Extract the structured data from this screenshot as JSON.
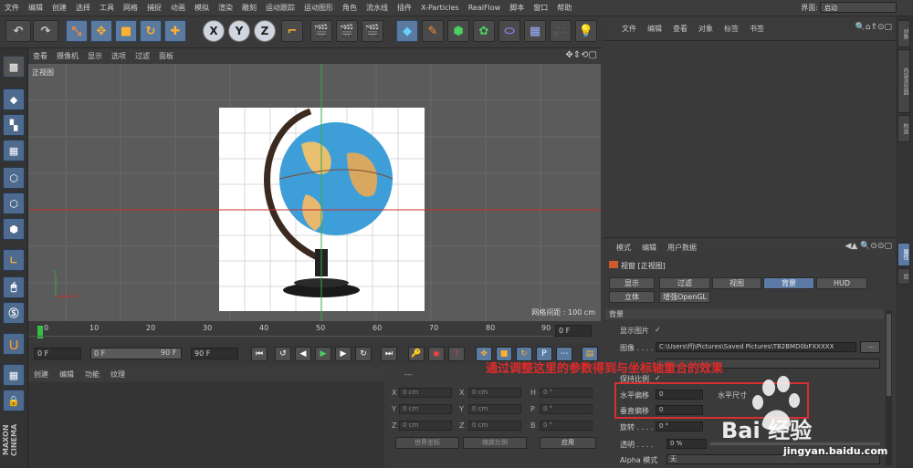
{
  "menubar": {
    "items": [
      "文件",
      "编辑",
      "创建",
      "选择",
      "工具",
      "网格",
      "捕捉",
      "动画",
      "模拟",
      "渲染",
      "雕刻",
      "运动跟踪",
      "运动图形",
      "角色",
      "流水线",
      "插件",
      "X-Particles",
      "RealFlow",
      "脚本",
      "窗口",
      "帮助"
    ],
    "layout_label": "界面:",
    "layout_value": "启动"
  },
  "toolbar": {
    "axis_x": "X",
    "axis_y": "Y",
    "axis_z": "Z"
  },
  "viewport": {
    "menu": [
      "查看",
      "摄像机",
      "显示",
      "选项",
      "过滤",
      "面板"
    ],
    "title": "正视图",
    "grid_spacing": "网格间距 : 100 cm"
  },
  "object_manager": {
    "menu": [
      "文件",
      "编辑",
      "查看",
      "对象",
      "标签",
      "书签"
    ]
  },
  "right_tabs": [
    "对象",
    "内容浏览器",
    "构造",
    "属性",
    "层"
  ],
  "attribute_manager": {
    "menu": [
      "模式",
      "编辑",
      "用户数据"
    ],
    "title": "视窗 [正视图]",
    "tabs_row1": [
      "显示",
      "过滤",
      "视图",
      "背景",
      "HUD"
    ],
    "tabs_row2": [
      "立体",
      "增强OpenGL"
    ],
    "active_tab": "背景",
    "section": "背景",
    "show_image_label": "显示图片",
    "show_image_check": "✓",
    "image_label": "图像 . . . . .",
    "image_path": "C:\\Users\\ffj\\Pictures\\Saved Pictures\\TB2BMD0bFXXXXX",
    "browse": "...",
    "keep_ratio_label": "保持比例",
    "keep_ratio_check": "✓",
    "h_offset_label": "水平偏移",
    "h_offset_value": "0",
    "h_size_label": "水平尺寸",
    "v_offset_label": "垂直偏移",
    "v_offset_value": "0",
    "rotation_label": "旋转 . . . .",
    "rotation_value": "0 °",
    "transparency_label": "透明 . . . .",
    "transparency_value": "0 %",
    "alpha_label": "Alpha 模式",
    "alpha_value": "无"
  },
  "annotation": "通过调整这里的参数得到与坐标轴重合的效果",
  "timeline": {
    "ticks": [
      "0",
      "10",
      "20",
      "30",
      "40",
      "50",
      "60",
      "70",
      "80",
      "90"
    ],
    "current_frame": "0 F"
  },
  "transport": {
    "start_field": "0 F",
    "range_start": "0 F",
    "range_end": "90 F",
    "end_field": "90 F"
  },
  "material_manager": {
    "menu": [
      "创建",
      "编辑",
      "功能",
      "纹理"
    ]
  },
  "coordinates": {
    "header": "---",
    "rows": [
      {
        "l1": "X",
        "v1": "0 cm",
        "l2": "X",
        "v2": "0 cm",
        "l3": "H",
        "v3": "0 °"
      },
      {
        "l1": "Y",
        "v1": "0 cm",
        "l2": "Y",
        "v2": "0 cm",
        "l3": "P",
        "v3": "0 °"
      },
      {
        "l1": "Z",
        "v1": "0 cm",
        "l2": "Z",
        "v2": "0 cm",
        "l3": "B",
        "v3": "0 °"
      }
    ],
    "world_coord": "世界坐标",
    "scale": "缩放比例",
    "apply": "应用"
  },
  "brand": {
    "vertical": "MAXON CINEMA",
    "watermark_text": "Bai 经验",
    "watermark_url": "jingyan.baidu.com"
  },
  "colors": {
    "accent_blue": "#5b7aa6",
    "annotation_red": "#e02a2a",
    "axis_red": "#c83030",
    "axis_green": "#3aa84a"
  }
}
